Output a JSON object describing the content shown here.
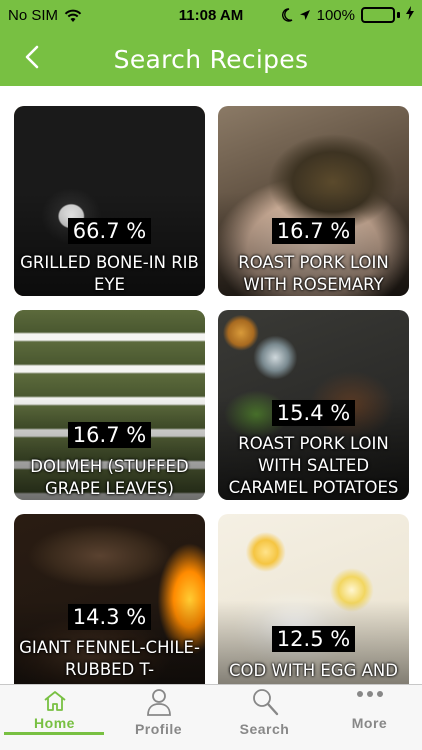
{
  "status_bar": {
    "carrier": "No SIM",
    "time": "11:08 AM",
    "battery": "100%"
  },
  "header": {
    "title": "Search Recipes",
    "back_icon": "chevron-left-icon"
  },
  "recipes": [
    {
      "match": "66.7 %",
      "title": "GRILLED BONE-IN RIB EYE"
    },
    {
      "match": "16.7 %",
      "title": "ROAST PORK LOIN WITH ROSEMARY"
    },
    {
      "match": "16.7 %",
      "title": "DOLMEH (STUFFED GRAPE LEAVES)"
    },
    {
      "match": "15.4 %",
      "title": "ROAST PORK LOIN WITH SALTED CARAMEL POTATOES"
    },
    {
      "match": "14.3 %",
      "title": "GIANT FENNEL-CHILE-RUBBED T-"
    },
    {
      "match": "12.5 %",
      "title": "COD WITH EGG AND"
    }
  ],
  "tab_bar": {
    "tabs": [
      {
        "label": "Home",
        "icon": "home-icon",
        "active": true
      },
      {
        "label": "Profile",
        "icon": "person-icon",
        "active": false
      },
      {
        "label": "Search",
        "icon": "search-icon",
        "active": false
      },
      {
        "label": "More",
        "icon": "more-dots-icon",
        "active": false
      }
    ]
  },
  "colors": {
    "accent": "#78c042",
    "tab_inactive": "#888888",
    "tab_bar_bg": "#f7f7f7"
  }
}
